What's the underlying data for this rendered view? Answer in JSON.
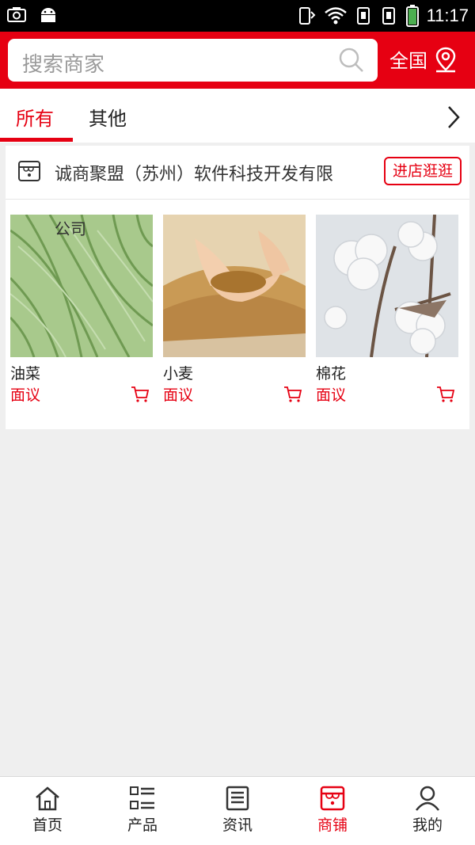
{
  "status_bar": {
    "time": "11:17",
    "battery_color": "#4caf50"
  },
  "header": {
    "search_placeholder": "搜索商家",
    "region_label": "全国",
    "brand_color": "#e60012"
  },
  "tabs": [
    {
      "label": "所有",
      "active": true
    },
    {
      "label": "其他",
      "active": false
    }
  ],
  "shop": {
    "name": "诚商聚盟（苏州）软件科技开发有限",
    "enter_label": "进店逛逛",
    "products": [
      {
        "name": "油菜",
        "price": "面议",
        "image": "rapeseed-pods",
        "overlay_text": "公司"
      },
      {
        "name": "小麦",
        "price": "面议",
        "image": "wheat-grains"
      },
      {
        "name": "棉花",
        "price": "面议",
        "image": "cotton-bolls"
      }
    ]
  },
  "bottom_nav": [
    {
      "label": "首页",
      "icon": "home-icon",
      "active": false
    },
    {
      "label": "产品",
      "icon": "list-icon",
      "active": false
    },
    {
      "label": "资讯",
      "icon": "news-icon",
      "active": false
    },
    {
      "label": "商铺",
      "icon": "store-icon",
      "active": true
    },
    {
      "label": "我的",
      "icon": "user-icon",
      "active": false
    }
  ]
}
